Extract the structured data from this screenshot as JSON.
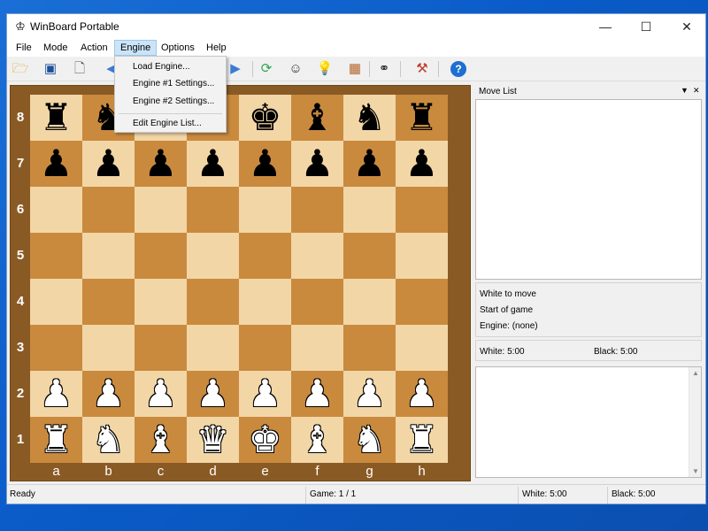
{
  "window": {
    "title": "WinBoard Portable",
    "minimize": "—",
    "maximize": "☐",
    "close": "✕"
  },
  "menu": [
    "File",
    "Mode",
    "Action",
    "Engine",
    "Options",
    "Help"
  ],
  "engine_menu": {
    "items": [
      "Load Engine...",
      "Engine #1 Settings...",
      "Engine #2 Settings...",
      "Edit Engine List..."
    ]
  },
  "toolbar": {
    "icons": [
      "open-folder-icon",
      "save-disk-icon",
      "document-icon",
      "back-arrow-icon",
      "forward-arrow-icon",
      "refresh-icon",
      "face-icon",
      "lightbulb-icon",
      "board-icon",
      "binoculars-icon",
      "tools-icon",
      "help-icon"
    ]
  },
  "board": {
    "ranks": [
      "8",
      "7",
      "6",
      "5",
      "4",
      "3",
      "2",
      "1"
    ],
    "files": [
      "a",
      "b",
      "c",
      "d",
      "e",
      "f",
      "g",
      "h"
    ],
    "position": [
      "rnbqkbnr",
      "pppppppp",
      "........",
      "........",
      "........",
      "........",
      "PPPPPPPP",
      "RNBQKBNR"
    ],
    "colors": {
      "light": "#f2d6a6",
      "dark": "#c98a3e",
      "frame": "#8a5a25"
    }
  },
  "move_list": {
    "title": "Move List"
  },
  "info": {
    "to_move": "White to move",
    "status": "Start of game",
    "engine": "Engine: (none)"
  },
  "clocks": {
    "white": "White:   5:00",
    "black": "Black:   5:00"
  },
  "statusbar": {
    "state": "Ready",
    "game": "Game:  1 / 1",
    "white": "White: 5:00",
    "black": "Black: 5:00"
  }
}
